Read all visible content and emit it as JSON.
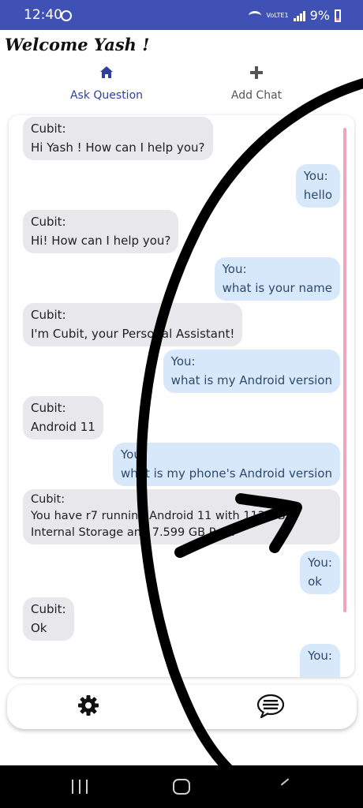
{
  "status": {
    "time": "12:40",
    "network": "VoLTE1",
    "battery": "9%"
  },
  "header": {
    "welcome": "Welcome Yash !"
  },
  "tabs": [
    {
      "label": "Ask Question",
      "icon": "home-icon",
      "active": true
    },
    {
      "label": "Add Chat",
      "icon": "plus-icon",
      "active": false
    }
  ],
  "messages": [
    {
      "sender": "Cubit:",
      "text": "Hi Yash ! How can I help you?"
    },
    {
      "sender": "You:",
      "text": "hello"
    },
    {
      "sender": "Cubit:",
      "text": "Hi! How can I help you?"
    },
    {
      "sender": "You:",
      "text": "what is your name"
    },
    {
      "sender": "Cubit:",
      "text": "I'm Cubit, your Personal Assistant!"
    },
    {
      "sender": "You:",
      "text": "what is my Android version"
    },
    {
      "sender": "Cubit:",
      "text": "Android 11"
    },
    {
      "sender": "You:",
      "text": "what is my phone's Android version"
    },
    {
      "sender": "Cubit:",
      "text": "You have r7 running Android 11 with 112 GB",
      "text2": "Internal Storage and 7.599 GB Ram"
    },
    {
      "sender": "You:",
      "text": "ok"
    },
    {
      "sender": "Cubit:",
      "text": "Ok"
    },
    {
      "sender": "You:",
      "text": ""
    }
  ],
  "bottom_bar": {
    "left_icon": "gear-icon",
    "right_icon": "chat-bubble-icon"
  },
  "colors": {
    "header": "#3f51b5",
    "cubit_bubble": "#e8e8ec",
    "user_bubble": "#d8e8fb",
    "scrollbar": "#f0a5bb"
  }
}
